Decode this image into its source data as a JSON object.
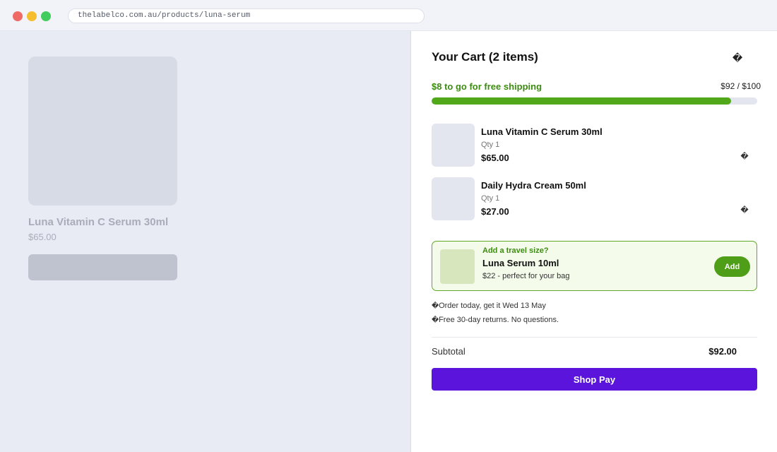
{
  "browser": {
    "url": "thelabelco.com.au/products/luna-serum"
  },
  "background_page": {
    "product_title": "Luna Vitamin C Serum 30ml",
    "product_price": "$65.00"
  },
  "cart": {
    "title": "Your Cart (2 items)",
    "close_icon": "close-icon",
    "shipping": {
      "message": "$8 to go for free shipping",
      "progress_text": "$92 / $100",
      "progress_fraction": 0.92,
      "bar_color": "#52a81b"
    },
    "items": [
      {
        "name": "Luna Vitamin C Serum 30ml",
        "qty": "Qty 1",
        "price": "$65.00",
        "remove_icon": "trash-icon"
      },
      {
        "name": "Daily Hydra Cream 50ml",
        "qty": "Qty 1",
        "price": "$27.00",
        "remove_icon": "trash-icon"
      }
    ],
    "upsell": {
      "eyebrow": "Add a travel size?",
      "name": "Luna Serum 10ml",
      "description": "$22 - perfect for your bag",
      "add_label": "Add",
      "accent_color": "#4f9e18"
    },
    "perks": [
      {
        "icon": "truck-icon",
        "text": "Order today, get it Wed 13 May"
      },
      {
        "icon": "return-icon",
        "text": "Free 30-day returns. No questions."
      }
    ],
    "subtotal_label": "Subtotal",
    "subtotal_value": "$92.00",
    "checkout_label": "Shop Pay",
    "checkout_color": "#5a14dc"
  }
}
